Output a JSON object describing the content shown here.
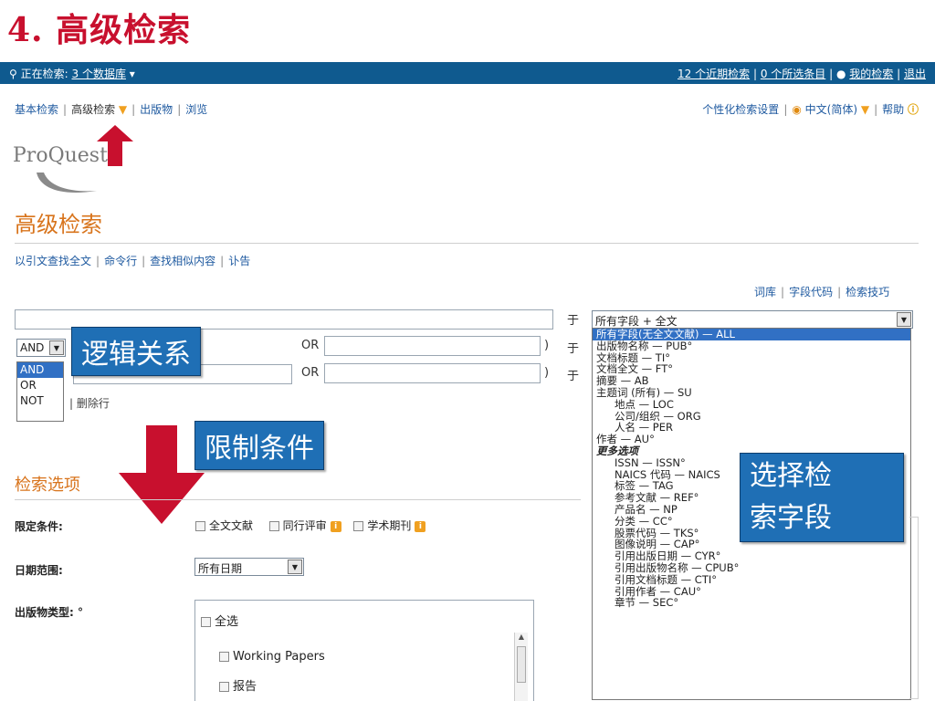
{
  "slide": {
    "title": "4.   高级检索"
  },
  "topbar": {
    "searching_prefix": "正在检索:",
    "databases": "3 个数据库",
    "recent": "12 个近期检索",
    "selected": "0 个所选条目",
    "my_search": "我的检索",
    "logout": "退出"
  },
  "nav": {
    "basic": "基本检索",
    "advanced": "高级检索",
    "publications": "出版物",
    "browse": "浏览",
    "prefs": "个性化检索设置",
    "language": "中文(简体)",
    "help": "帮助"
  },
  "logo": {
    "text": "ProQuest"
  },
  "page": {
    "heading": "高级检索"
  },
  "sublinks": [
    "以引文查找全文",
    "命令行",
    "查找相似内容",
    "讣告"
  ],
  "helplinks": [
    "词库",
    "字段代码",
    "检索技巧"
  ],
  "search_form": {
    "in_label": "于",
    "or_label": "OR",
    "close_paren": ")",
    "field_selected": "所有字段 + 全文",
    "operator_selected": "AND",
    "operators": [
      "AND",
      "OR",
      "NOT"
    ],
    "delete_row": "删除行",
    "field_options": [
      "所有字段(无全文文献) — ALL",
      "出版物名称 — PUB°",
      "文档标题 — TI°",
      "文档全文 — FT°",
      "摘要 — AB",
      "主题词 (所有) — SU",
      "地点 — LOC",
      "公司/组织 — ORG",
      "人名 — PER",
      "作者 — AU°",
      "更多选项",
      "ISSN — ISSN°",
      "NAICS 代码 — NAICS",
      "标签 — TAG",
      "参考文献 — REF°",
      "产品名 — NP",
      "分类 — CC°",
      "股票代码 — TKS°",
      "图像说明 — CAP°",
      "引用出版日期 — CYR°",
      "引用出版物名称 — CPUB°",
      "引用文档标题 — CTI°",
      "引用作者 — CAU°",
      "章节 — SEC°"
    ]
  },
  "callouts": {
    "logic": "逻辑关系",
    "limits": "限制条件",
    "field_line1": "选择检",
    "field_line2": "索字段"
  },
  "options": {
    "heading": "检索选项",
    "limit_label": "限定条件:",
    "fulltext": "全文文献",
    "peer_reviewed": "同行评审",
    "scholarly": "学术期刊",
    "date_label": "日期范围:",
    "date_value": "所有日期",
    "pubtype_label": "出版物类型: °",
    "pubtypes": [
      "全选",
      "Working Papers",
      "报告"
    ]
  }
}
